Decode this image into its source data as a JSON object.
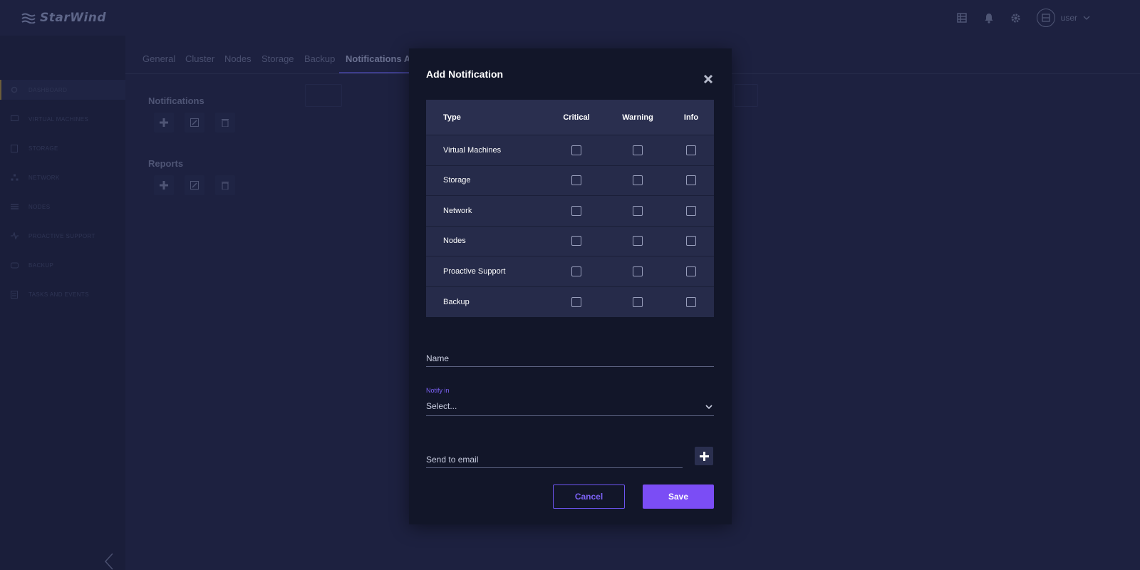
{
  "app": {
    "logo_text": "StarWind",
    "user_label": "user"
  },
  "header_icons": [
    "table-icon",
    "bell-icon",
    "gear-icon",
    "avatar-icon",
    "chevron-down-icon"
  ],
  "sidebar": {
    "items": [
      {
        "label": "DASHBOARD",
        "icon": "home-icon"
      },
      {
        "label": "VIRTUAL MACHINES",
        "icon": "monitor-icon"
      },
      {
        "label": "STORAGE",
        "icon": "storage-icon"
      },
      {
        "label": "NETWORK",
        "icon": "network-icon"
      },
      {
        "label": "NODES",
        "icon": "server-icon"
      },
      {
        "label": "PROACTIVE SUPPORT",
        "icon": "pulse-icon"
      },
      {
        "label": "BACKUP",
        "icon": "backup-icon"
      },
      {
        "label": "TASKS AND EVENTS",
        "icon": "list-icon"
      }
    ]
  },
  "tabs": [
    "General",
    "Cluster",
    "Nodes",
    "Storage",
    "Backup",
    "Notifications An"
  ],
  "sections": {
    "notifications_title": "Notifications",
    "reports_title": "Reports"
  },
  "modal": {
    "title": "Add Notification",
    "table": {
      "headers": [
        "Type",
        "Critical",
        "Warning",
        "Info"
      ],
      "rows": [
        {
          "type": "Virtual Machines",
          "critical": false,
          "warning": false,
          "info": false
        },
        {
          "type": "Storage",
          "critical": false,
          "warning": false,
          "info": false
        },
        {
          "type": "Network",
          "critical": false,
          "warning": false,
          "info": false
        },
        {
          "type": "Nodes",
          "critical": false,
          "warning": false,
          "info": false
        },
        {
          "type": "Proactive Support",
          "critical": false,
          "warning": false,
          "info": false
        },
        {
          "type": "Backup",
          "critical": false,
          "warning": false,
          "info": false
        }
      ]
    },
    "name_placeholder": "Name",
    "notify_in_label": "Notify in",
    "notify_in_value": "Select...",
    "email_placeholder": "Send to email",
    "cancel_label": "Cancel",
    "save_label": "Save"
  },
  "colors": {
    "accent": "#7b4df5",
    "accent_text": "#7c62f5",
    "modal_bg": "#121629",
    "table_bg": "#262b4a",
    "backdrop": "#1d2140"
  }
}
